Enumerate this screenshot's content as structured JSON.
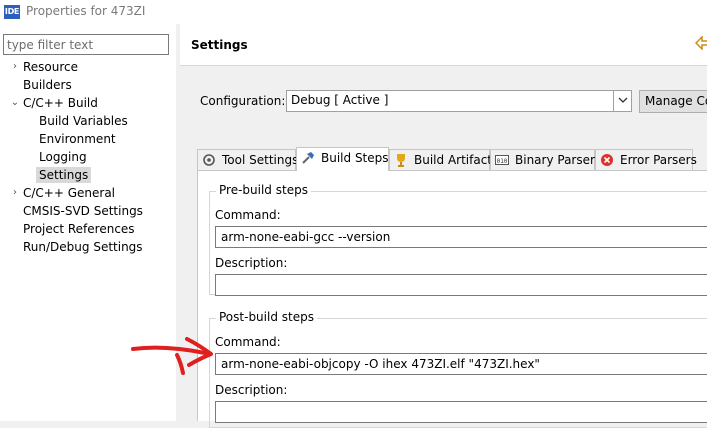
{
  "window": {
    "icon_label": "IDE",
    "title": "Properties for 473ZI"
  },
  "filter": {
    "placeholder": "type filter text"
  },
  "tree": [
    {
      "label": "Resource",
      "twisty": "›"
    },
    {
      "label": "Builders"
    },
    {
      "label": "C/C++ Build",
      "twisty": "⌄"
    },
    {
      "label": "Build Variables"
    },
    {
      "label": "Environment"
    },
    {
      "label": "Logging"
    },
    {
      "label": "Settings"
    },
    {
      "label": "C/C++ General",
      "twisty": "›"
    },
    {
      "label": "CMSIS-SVD Settings"
    },
    {
      "label": "Project References"
    },
    {
      "label": "Run/Debug Settings"
    }
  ],
  "header": {
    "title": "Settings"
  },
  "configuration": {
    "label": "Configuration:",
    "value": "Debug  [ Active ]",
    "manage_label": "Manage Co"
  },
  "tabs": [
    {
      "label": "Tool Settings",
      "icon": "gear-icon"
    },
    {
      "label": "Build Steps",
      "icon": "hammer-icon"
    },
    {
      "label": "Build Artifact",
      "icon": "trophy-icon"
    },
    {
      "label": "Binary Parsers",
      "icon": "binary-icon"
    },
    {
      "label": "Error Parsers",
      "icon": "error-icon"
    }
  ],
  "prebuild": {
    "group_title": "Pre-build steps",
    "command_label": "Command:",
    "command_value": "arm-none-eabi-gcc --version",
    "description_label": "Description:",
    "description_value": ""
  },
  "postbuild": {
    "group_title": "Post-build steps",
    "command_label": "Command:",
    "command_value": "arm-none-eabi-objcopy  -O ihex  473ZI.elf  \"473ZI.hex\"",
    "description_label": "Description:",
    "description_value": ""
  },
  "colors": {
    "annotation": "#e0201e",
    "selected_row": "#d9d9d9"
  }
}
